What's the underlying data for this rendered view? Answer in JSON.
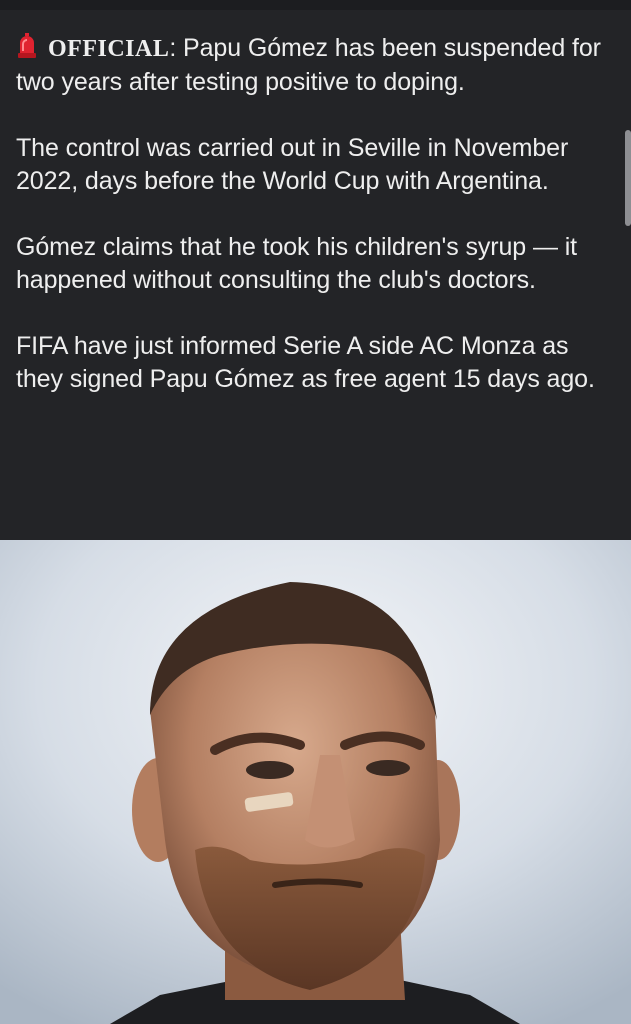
{
  "post": {
    "tag": "OFFICIAL",
    "tag_colon": ":",
    "line1_rest": " Papu Gómez has been suspended for two years after testing positive to doping.",
    "para2": "The control was carried out in Seville in November 2022, days before the World Cup with Argentina.",
    "para3": "Gómez claims that he took his children's syrup — it happened without consulting the club's doctors.",
    "para4": "FIFA have just informed Serie A side AC Monza as they signed Papu Gómez as free agent 15 days ago.",
    "icon": "siren-icon"
  },
  "photo": {
    "subject": "player-portrait"
  },
  "colors": {
    "background": "#232427",
    "text": "#eeeeee",
    "siren": "#d9202a"
  }
}
